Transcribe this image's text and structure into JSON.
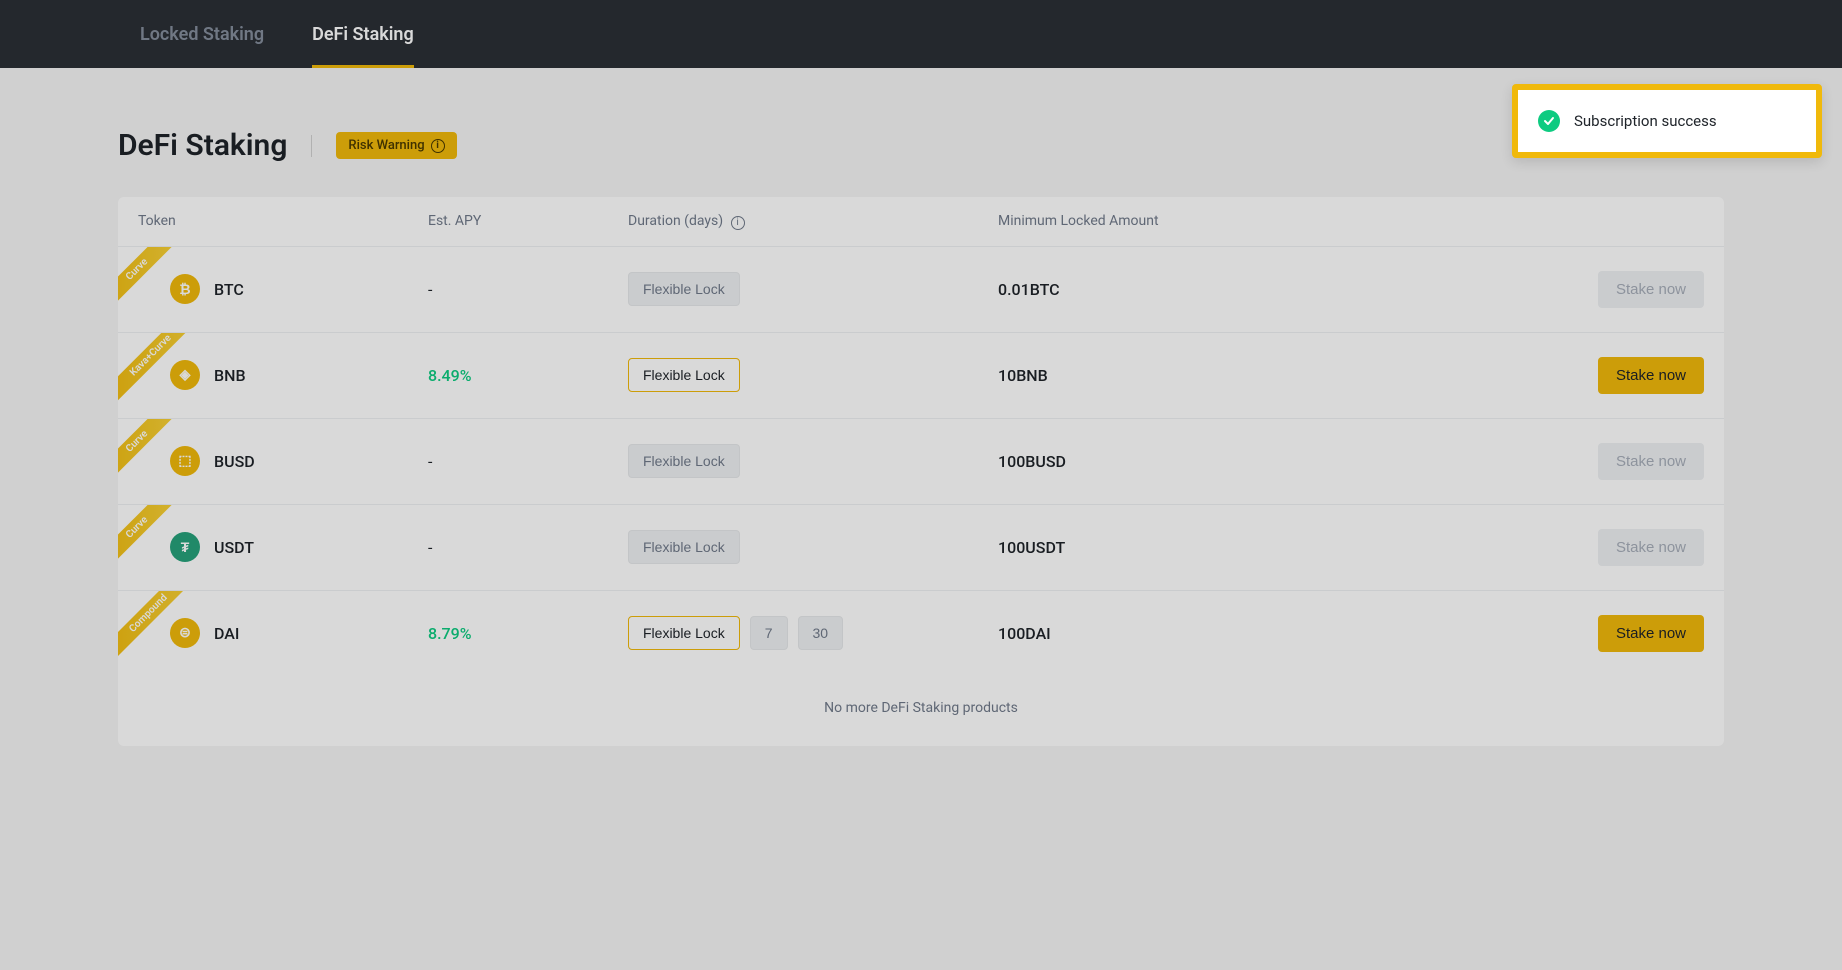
{
  "nav": {
    "tabs": [
      {
        "label": "Locked Staking",
        "active": false
      },
      {
        "label": "DeFi Staking",
        "active": true
      }
    ]
  },
  "page": {
    "title": "DeFi Staking",
    "risk_warning": "Risk Warning"
  },
  "columns": {
    "token": "Token",
    "apy": "Est. APY",
    "duration": "Duration (days)",
    "min": "Minimum Locked Amount"
  },
  "rows": [
    {
      "ribbon": "Curve",
      "symbol": "BTC",
      "coin_glyph": "₿",
      "coin_bg": "#f0b90b",
      "apy": "-",
      "apy_green": false,
      "durations": [
        {
          "label": "Flexible Lock",
          "active": false
        }
      ],
      "min": "0.01BTC",
      "stake_label": "Stake now",
      "stake_enabled": false
    },
    {
      "ribbon": "Kava+Curve",
      "symbol": "BNB",
      "coin_glyph": "◈",
      "coin_bg": "#f0b90b",
      "apy": "8.49%",
      "apy_green": true,
      "durations": [
        {
          "label": "Flexible Lock",
          "active": true
        }
      ],
      "min": "10BNB",
      "stake_label": "Stake now",
      "stake_enabled": true
    },
    {
      "ribbon": "Curve",
      "symbol": "BUSD",
      "coin_glyph": "⬚",
      "coin_bg": "#f0b90b",
      "apy": "-",
      "apy_green": false,
      "durations": [
        {
          "label": "Flexible Lock",
          "active": false
        }
      ],
      "min": "100BUSD",
      "stake_label": "Stake now",
      "stake_enabled": false
    },
    {
      "ribbon": "Curve",
      "symbol": "USDT",
      "coin_glyph": "₮",
      "coin_bg": "#26a17b",
      "apy": "-",
      "apy_green": false,
      "durations": [
        {
          "label": "Flexible Lock",
          "active": false
        }
      ],
      "min": "100USDT",
      "stake_label": "Stake now",
      "stake_enabled": false
    },
    {
      "ribbon": "Compound",
      "symbol": "DAI",
      "coin_glyph": "⊜",
      "coin_bg": "#f0b90b",
      "apy": "8.79%",
      "apy_green": true,
      "durations": [
        {
          "label": "Flexible Lock",
          "active": true
        },
        {
          "label": "7",
          "active": false
        },
        {
          "label": "30",
          "active": false
        }
      ],
      "min": "100DAI",
      "stake_label": "Stake now",
      "stake_enabled": true
    }
  ],
  "footer": "No more DeFi Staking products",
  "toast": {
    "message": "Subscription success"
  }
}
